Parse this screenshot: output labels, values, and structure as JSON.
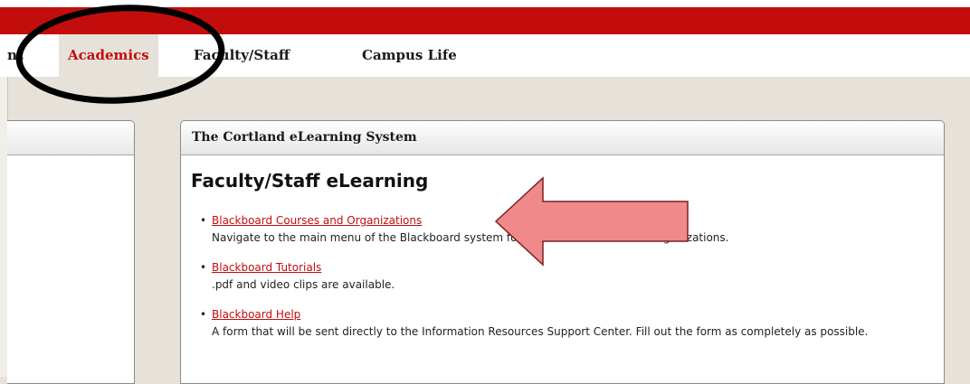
{
  "nav": {
    "items": [
      {
        "label": "nt",
        "active": false
      },
      {
        "label": "Academics",
        "active": true
      },
      {
        "label": "Faculty/Staff",
        "active": false
      },
      {
        "label": "Campus Life",
        "active": false
      }
    ]
  },
  "main_panel": {
    "header": "The Cortland eLearning System",
    "title": "Faculty/Staff eLearning",
    "links": [
      {
        "label": "Blackboard Courses and Organizations",
        "description": "Navigate to the main menu of the Blackboard system for access to Courses and Organizations."
      },
      {
        "label": "Blackboard Tutorials",
        "description": ".pdf and video clips are available."
      },
      {
        "label": "Blackboard Help",
        "description": "A form that will be sent directly to the Information Resources Support Center. Fill out the form as completely as possible."
      }
    ]
  },
  "colors": {
    "brand_red": "#c30d0d",
    "background": "#e6e2da",
    "annotation_arrow": "#f08a8a"
  },
  "annotations": [
    "ellipse-highlight",
    "arrow-pointer"
  ]
}
